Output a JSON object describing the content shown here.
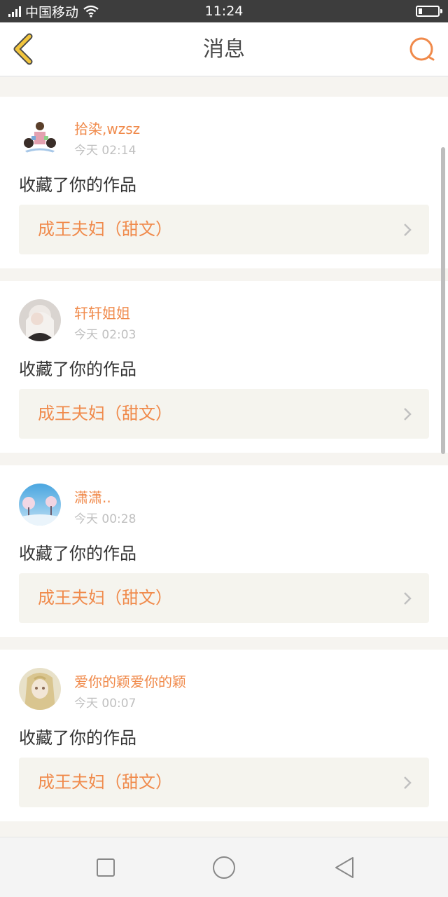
{
  "status_bar": {
    "carrier": "中国移动",
    "time": "11:24",
    "battery_level": 0.2
  },
  "header": {
    "title": "消息",
    "back_icon": "chevron-left-icon",
    "search_icon": "search-icon"
  },
  "notifications": [
    {
      "username": "拾染,wzsz",
      "time": "今天 02:14",
      "action": "收藏了你的作品",
      "work_title": "成王夫妇（甜文）"
    },
    {
      "username": "轩轩姐姐",
      "time": "今天 02:03",
      "action": "收藏了你的作品",
      "work_title": "成王夫妇（甜文）"
    },
    {
      "username": "潇潇..",
      "time": "今天 00:28",
      "action": "收藏了你的作品",
      "work_title": "成王夫妇（甜文）"
    },
    {
      "username": "爱你的颖爱你的颖",
      "time": "今天 00:07",
      "action": "收藏了你的作品",
      "work_title": "成王夫妇（甜文）"
    }
  ],
  "nav_bar": {
    "recent_icon": "square-icon",
    "home_icon": "circle-icon",
    "back_icon": "triangle-back-icon"
  },
  "colors": {
    "accent": "#f08a4b",
    "back_chevron": "#f2c53d",
    "status_bar": "#3d3d3d"
  }
}
